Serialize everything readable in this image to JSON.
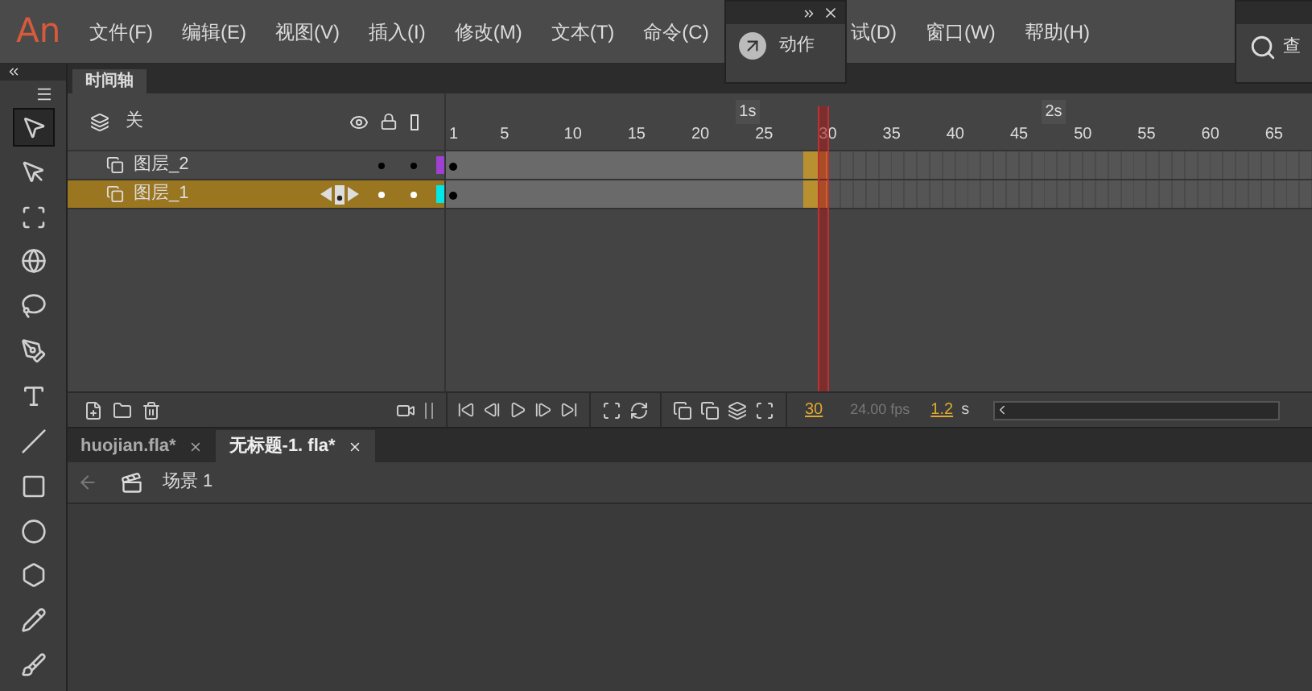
{
  "app_logo": "An",
  "menu": [
    "文件(F)",
    "编辑(E)",
    "视图(V)",
    "插入(I)",
    "修改(M)",
    "文本(T)",
    "命令(C)",
    "试(D)",
    "窗口(W)",
    "帮助(H)"
  ],
  "actions_panel": {
    "label": "动作"
  },
  "right_panel": {
    "label": "查"
  },
  "tools": [
    {
      "kind": "selection",
      "selected": true
    },
    {
      "kind": "subselection",
      "selected": false
    },
    {
      "kind": "transform",
      "selected": false
    },
    {
      "kind": "rotate3d",
      "selected": false
    },
    {
      "kind": "lasso",
      "selected": false
    },
    {
      "kind": "pen",
      "selected": false
    },
    {
      "kind": "text",
      "selected": false
    },
    {
      "kind": "line",
      "selected": false
    },
    {
      "kind": "rectangle",
      "selected": false
    },
    {
      "kind": "oval",
      "selected": false
    },
    {
      "kind": "polystar",
      "selected": false
    },
    {
      "kind": "pencil",
      "selected": false
    },
    {
      "kind": "brush",
      "selected": false
    }
  ],
  "timeline": {
    "tab": "时间轴",
    "header_label": "关",
    "ruler": [
      "1",
      "5",
      "10",
      "15",
      "20",
      "25",
      "30",
      "35",
      "40",
      "45",
      "50",
      "55",
      "60",
      "65"
    ],
    "seconds": [
      "1s",
      "2s"
    ],
    "layers": [
      {
        "name": "图层_2",
        "selected": false,
        "color": "#a040d0"
      },
      {
        "name": "图层_1",
        "selected": true,
        "color": "#00e8e8"
      }
    ],
    "current_frame": "30",
    "fps": "24.00 fps",
    "time": "1.2",
    "time_unit": "s"
  },
  "documents": [
    {
      "name": "huojian.fla*",
      "selected": false
    },
    {
      "name": "无标题-1. fla*",
      "selected": true
    }
  ],
  "scene": "场景 1"
}
